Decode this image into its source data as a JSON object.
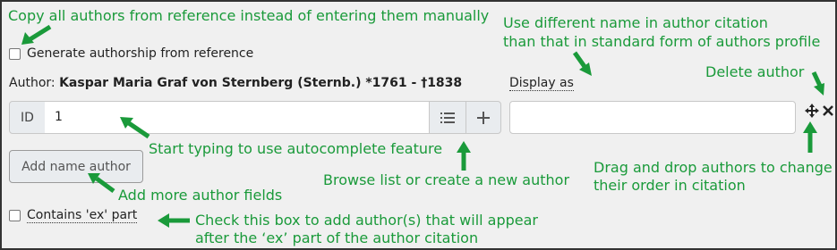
{
  "annotations": {
    "copy_authors": "Copy all authors from reference instead of entering them manually",
    "different_name_line1": "Use different name in author citation",
    "different_name_line2": "than that in standard form of authors profile",
    "delete_author": "Delete author",
    "autocomplete": "Start typing to use autocomplete feature",
    "browse_create": "Browse list or create a new author",
    "drag_drop_line1": "Drag and drop authors to change",
    "drag_drop_line2": "their order in citation",
    "add_more": "Add more author fields",
    "ex_part_line1": "Check this box to add author(s) that will appear",
    "ex_part_line2": "after the ‘ex’ part of the author citation"
  },
  "form": {
    "generate_label": "Generate authorship from reference",
    "author_prefix": "Author:",
    "author_name": "Kaspar Maria Graf von Sternberg (Sternb.) *1761 - †1838",
    "display_as_label": "Display as",
    "id_label": "ID",
    "id_value": "1",
    "display_value": "",
    "add_name_author_label": "Add name author",
    "contains_ex_label": "Contains 'ex' part"
  },
  "icons": {
    "list": "list-icon",
    "plus": "plus-icon",
    "move": "move-icon",
    "delete": "close-icon",
    "arrow_color": "#1a9a3a"
  }
}
